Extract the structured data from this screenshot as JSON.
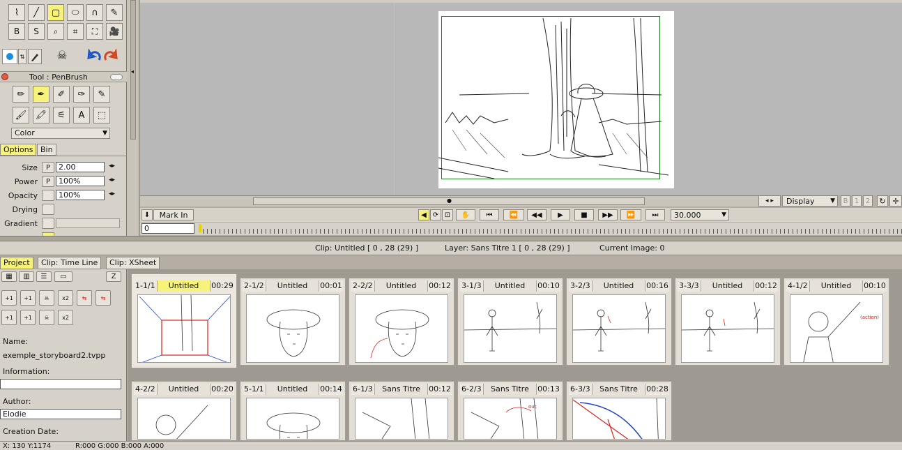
{
  "tool_panel": {
    "title": "Tool : PenBrush",
    "mode_select": "Color",
    "tabs": [
      "Options",
      "Bin"
    ],
    "props": [
      {
        "label": "Size",
        "flag": "P",
        "value": "2.00"
      },
      {
        "label": "Power",
        "flag": "P",
        "value": "100%"
      },
      {
        "label": "Opacity",
        "flag": "",
        "value": "100%"
      },
      {
        "label": "Drying",
        "flag": "",
        "value": ""
      },
      {
        "label": "Gradient",
        "flag": "",
        "value": ""
      }
    ],
    "tools_row1": [
      "freehand-icon",
      "line-icon",
      "rectangle-icon",
      "ellipse-icon",
      "bezier-icon",
      "pen-marker-icon"
    ],
    "tools_row2": [
      "bucket-b-icon",
      "select-s-icon",
      "zoom-icon",
      "crop-icon",
      "transform-icon",
      "camera-icon"
    ],
    "brushes_row1": [
      "pencil-icon",
      "pen-icon",
      "marker-icon",
      "airbrush-icon",
      "felt-pen-icon"
    ],
    "brushes_row2": [
      "paintbrush-icon",
      "oil-brush-icon",
      "knife-icon",
      "text-icon",
      "select-rect-icon"
    ]
  },
  "viewer": {
    "mark_in": "Mark In",
    "frame_field": "0",
    "fps": "30.000",
    "display": "Display",
    "page_nums": [
      "B",
      "1",
      "2"
    ]
  },
  "status_bar": {
    "clip": "Clip: Untitled [ 0 , 28  (29) ]",
    "layer": "Layer: Sans Titre 1 [ 0 , 28  (29) ]",
    "image": "Current Image: 0"
  },
  "tabs": [
    "Project",
    "Clip: Time Line",
    "Clip: XSheet"
  ],
  "project_panel": {
    "z_button": "Z",
    "name_label": "Name:",
    "name_value": "exemple_storyboard2.tvpp",
    "info_label": "Information:",
    "info_value": "",
    "author_label": "Author:",
    "author_value": "Elodie",
    "date_label": "Creation Date:",
    "buttons_row1": [
      "+1",
      "+1",
      "",
      "x2",
      "",
      ""
    ],
    "buttons_row2": [
      "+1",
      "+1",
      "",
      "x2"
    ]
  },
  "clips": [
    {
      "id": "1-1/1",
      "name": "Untitled",
      "time": "00:29",
      "selected": true
    },
    {
      "id": "2-1/2",
      "name": "Untitled",
      "time": "00:01",
      "selected": false
    },
    {
      "id": "2-2/2",
      "name": "Untitled",
      "time": "00:12",
      "selected": false
    },
    {
      "id": "3-1/3",
      "name": "Untitled",
      "time": "00:10",
      "selected": false
    },
    {
      "id": "3-2/3",
      "name": "Untitled",
      "time": "00:16",
      "selected": false
    },
    {
      "id": "3-3/3",
      "name": "Untitled",
      "time": "00:12",
      "selected": false
    },
    {
      "id": "4-1/2",
      "name": "Untitled",
      "time": "00:10",
      "selected": false
    },
    {
      "id": "4-2/2",
      "name": "Untitled",
      "time": "00:20",
      "selected": false
    },
    {
      "id": "5-1/1",
      "name": "Untitled",
      "time": "00:14",
      "selected": false
    },
    {
      "id": "6-1/3",
      "name": "Sans Titre",
      "time": "00:12",
      "selected": false
    },
    {
      "id": "6-2/3",
      "name": "Sans Titre",
      "time": "00:13",
      "selected": false
    },
    {
      "id": "6-3/3",
      "name": "Sans Titre",
      "time": "00:28",
      "selected": false
    }
  ],
  "coords": "X: 130  Y:1174",
  "color_readout": "R:000 G:000 B:000 A:000",
  "colors": {
    "highlight": "#f6f27a",
    "panel": "#d7d2c9",
    "frame_border": "#1c7a1c"
  }
}
